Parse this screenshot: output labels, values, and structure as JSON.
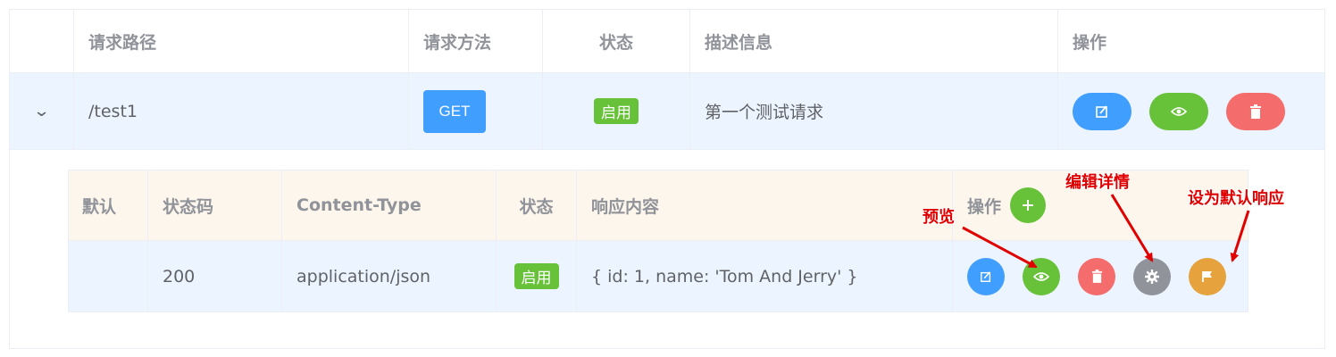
{
  "main_table": {
    "headers": [
      "请求路径",
      "请求方法",
      "状态",
      "描述信息",
      "操作"
    ],
    "row": {
      "path": "/test1",
      "method": "GET",
      "status": "启用",
      "description": "第一个测试请求"
    }
  },
  "response_table": {
    "headers": [
      "默认",
      "状态码",
      "Content-Type",
      "状态",
      "响应内容",
      "操作"
    ],
    "row": {
      "default": "",
      "status_code": "200",
      "content_type": "application/json",
      "status": "启用",
      "content": "{ id: 1, name: 'Tom And Jerry' }"
    }
  },
  "annotations": {
    "preview": "预览",
    "edit_details": "编辑详情",
    "set_default": "设为默认响应"
  },
  "colors": {
    "primary": "#409eff",
    "success": "#67c23a",
    "danger": "#f56c6c",
    "info": "#909399",
    "warning": "#e6a23c",
    "annotation": "#e00000"
  }
}
